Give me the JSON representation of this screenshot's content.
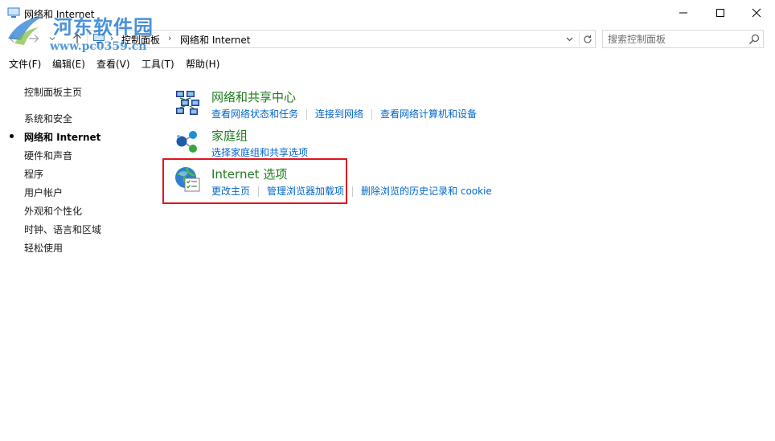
{
  "window": {
    "title": "网络和 Internet",
    "controls": {
      "minimize": "minimize",
      "maximize": "maximize",
      "close": "close"
    }
  },
  "watermark": {
    "title": "河东软件园",
    "url": "www.pc0359.cn"
  },
  "address": {
    "crumbs": [
      "控制面板",
      "网络和 Internet"
    ]
  },
  "search": {
    "placeholder": "搜索控制面板"
  },
  "menu": [
    "文件(F)",
    "编辑(E)",
    "查看(V)",
    "工具(T)",
    "帮助(H)"
  ],
  "sidebar": {
    "items": [
      {
        "label": "控制面板主页",
        "active": false
      },
      {
        "label": "系统和安全",
        "active": false
      },
      {
        "label": "网络和 Internet",
        "active": true
      },
      {
        "label": "硬件和声音",
        "active": false
      },
      {
        "label": "程序",
        "active": false
      },
      {
        "label": "用户帐户",
        "active": false
      },
      {
        "label": "外观和个性化",
        "active": false
      },
      {
        "label": "时钟、语言和区域",
        "active": false
      },
      {
        "label": "轻松使用",
        "active": false
      }
    ]
  },
  "categories": [
    {
      "title": "网络和共享中心",
      "icon": "network-sharing-icon",
      "links": [
        "查看网络状态和任务",
        "连接到网络",
        "查看网络计算机和设备"
      ]
    },
    {
      "title": "家庭组",
      "icon": "homegroup-icon",
      "links": [
        "选择家庭组和共享选项"
      ]
    },
    {
      "title": "Internet 选项",
      "icon": "internet-options-icon",
      "links": [
        "更改主页",
        "管理浏览器加载项",
        "删除浏览的历史记录和 cookie"
      ]
    }
  ],
  "colors": {
    "link": "#0066cc",
    "category_title": "#1e7b1e",
    "highlight": "#e3141b",
    "watermark": "#2a7ed3"
  }
}
